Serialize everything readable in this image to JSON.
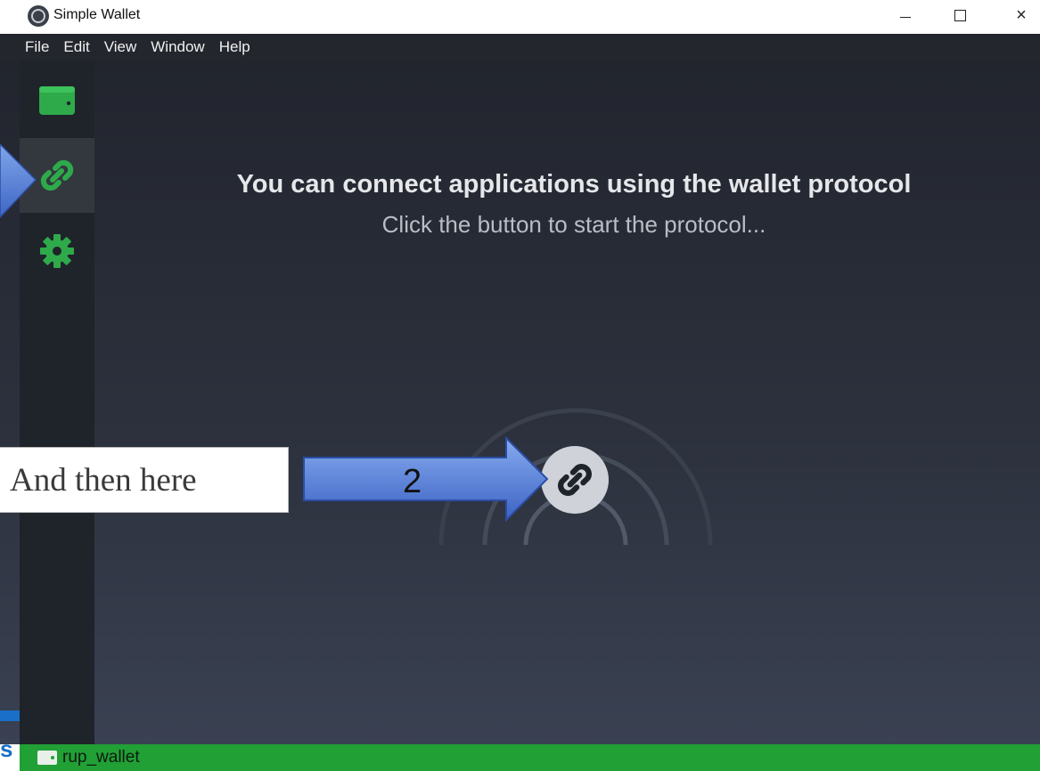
{
  "window": {
    "title": "Simple Wallet",
    "controls": {
      "minimize": "minimize",
      "maximize": "maximize",
      "close": "×"
    }
  },
  "menu": {
    "items": [
      "File",
      "Edit",
      "View",
      "Window",
      "Help"
    ]
  },
  "sidebar": {
    "items": [
      {
        "name": "wallet",
        "icon": "wallet-icon",
        "active": false
      },
      {
        "name": "connect",
        "icon": "link-icon",
        "active": true
      },
      {
        "name": "settings",
        "icon": "gear-icon",
        "active": false
      }
    ],
    "accent": "#2eaa4a"
  },
  "main": {
    "heading": "You can connect applications using the wallet protocol",
    "subheading": "Click the button to start the protocol...",
    "connect_button_icon": "link-icon"
  },
  "annotations": {
    "callout": "And then here",
    "arrow_label": "2"
  },
  "left_fragment": {
    "text": "s"
  },
  "statusbar": {
    "wallet_name": "rup_wallet",
    "color": "#21a035"
  }
}
